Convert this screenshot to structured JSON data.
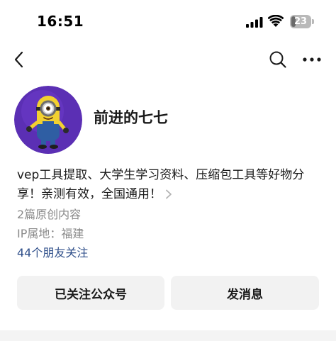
{
  "status_bar": {
    "time": "16:51",
    "battery": {
      "level_text": "23",
      "level_fraction": 0.23
    },
    "icons": [
      "signal-icon",
      "wifi-icon",
      "battery-icon"
    ]
  },
  "nav": {
    "icons": [
      "chevron-left-icon",
      "search-icon",
      "more-dots-icon"
    ]
  },
  "profile": {
    "avatar_icon": "minion-avatar",
    "name": "前进的七七",
    "bio_line_1": "vep工具提取、大学生学习资料、压缩包工具等好物分",
    "bio_line_2": "享！亲测有效，全国通用！",
    "articles": "2篇原创内容",
    "ip_location": "IP属地：福建",
    "friends_follow": "44个朋友关注"
  },
  "actions": {
    "followed_label": "已关注公众号",
    "message_label": "发消息"
  },
  "colors": {
    "accent_link": "#2f4f8a",
    "muted_text": "#8a8a8a",
    "button_bg": "#f2f2f2",
    "avatar_bg": "#5b2fb4"
  }
}
